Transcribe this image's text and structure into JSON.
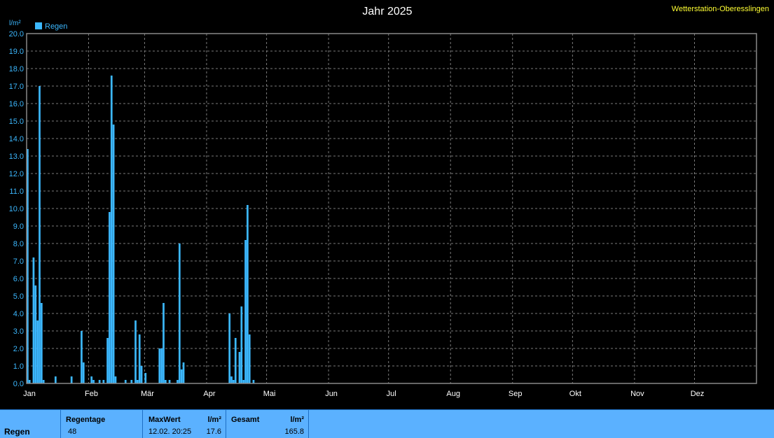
{
  "header": {
    "title": "Jahr 2025",
    "station": "Wetterstation-Oberesslingen"
  },
  "chart_data": {
    "type": "bar",
    "title": "Jahr 2025",
    "ylabel": "l/m²",
    "ylim": [
      0,
      20
    ],
    "yticks": [
      "0.0",
      "1.0",
      "2.0",
      "3.0",
      "4.0",
      "5.0",
      "6.0",
      "7.0",
      "8.0",
      "9.0",
      "10.0",
      "11.0",
      "12.0",
      "13.0",
      "14.0",
      "15.0",
      "16.0",
      "17.0",
      "18.0",
      "19.0",
      "20.0"
    ],
    "month_labels": [
      "Jan",
      "Feb",
      "Mär",
      "Apr",
      "Mai",
      "Jun",
      "Jul",
      "Aug",
      "Sep",
      "Okt",
      "Nov",
      "Dez"
    ],
    "grid": true,
    "legend": "top-left",
    "series": [
      {
        "name": "Regen",
        "color": "#3cb8ff",
        "x": [
          "01.01.",
          "02.01.",
          "04.01.",
          "05.01.",
          "06.01.",
          "07.01.",
          "08.01.",
          "09.01.",
          "15.01.",
          "23.01.",
          "28.01.",
          "29.01.",
          "02.02.",
          "03.02.",
          "06.02.",
          "08.02.",
          "10.02.",
          "11.02.",
          "12.02.",
          "13.02.",
          "14.02.",
          "19.02.",
          "22.02.",
          "24.02.",
          "25.02.",
          "26.02.",
          "27.02.",
          "01.03.",
          "08.03.",
          "09.03.",
          "10.03.",
          "11.03.",
          "13.03.",
          "17.03.",
          "18.03.",
          "19.03.",
          "20.03.",
          "12.04.",
          "13.04.",
          "14.04.",
          "15.04.",
          "17.04.",
          "18.04.",
          "19.04.",
          "20.04.",
          "21.04.",
          "22.04.",
          "24.04."
        ],
        "values": [
          13.4,
          0.2,
          7.2,
          5.6,
          3.6,
          17.0,
          4.6,
          0.2,
          0.4,
          0.4,
          3.0,
          1.2,
          0.4,
          0.2,
          0.2,
          0.2,
          2.6,
          9.8,
          17.6,
          14.8,
          0.4,
          0.2,
          0.2,
          3.6,
          0.2,
          2.8,
          1.0,
          0.6,
          2.0,
          2.0,
          4.6,
          0.2,
          0.2,
          0.2,
          8.0,
          0.8,
          1.2,
          4.0,
          0.4,
          0.2,
          2.6,
          1.8,
          4.4,
          0.2,
          8.2,
          10.2,
          2.8,
          0.2
        ]
      }
    ]
  },
  "stats": {
    "row_label": "Regen",
    "regentage_label": "Regentage",
    "regentage_value": "48",
    "maxwert_label": "MaxWert",
    "maxwert_unit": "l/m²",
    "maxwert_date": "12.02.  20:25",
    "maxwert_value": "17.6",
    "gesamt_label": "Gesamt",
    "gesamt_unit": "l/m²",
    "gesamt_value": "165.8"
  }
}
